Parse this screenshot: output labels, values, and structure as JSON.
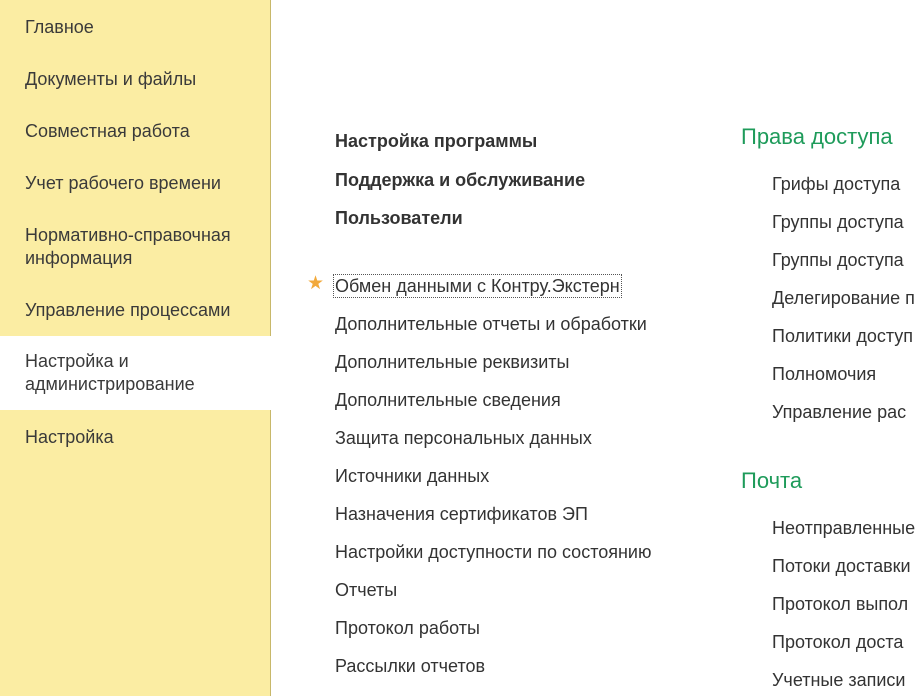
{
  "sidebar": {
    "items": [
      {
        "label": "Главное"
      },
      {
        "label": "Документы и файлы"
      },
      {
        "label": "Совместная работа"
      },
      {
        "label": "Учет рабочего времени"
      },
      {
        "label": "Нормативно-справочная информация"
      },
      {
        "label": "Управление процессами"
      },
      {
        "label": "Настройка и администрирование"
      },
      {
        "label": "Настройка"
      }
    ],
    "active_index": 6
  },
  "main": {
    "top_links": [
      {
        "label": "Настройка программы"
      },
      {
        "label": "Поддержка и обслуживание"
      },
      {
        "label": "Пользователи"
      }
    ],
    "favorite_link": {
      "label": "Обмен данными с Контру.Экстерн"
    },
    "links": [
      {
        "label": "Дополнительные отчеты и обработки"
      },
      {
        "label": "Дополнительные реквизиты"
      },
      {
        "label": "Дополнительные сведения"
      },
      {
        "label": "Защита персональных данных"
      },
      {
        "label": "Источники данных"
      },
      {
        "label": "Назначения сертификатов ЭП"
      },
      {
        "label": "Настройки доступности по состоянию"
      },
      {
        "label": "Отчеты"
      },
      {
        "label": "Протокол работы"
      },
      {
        "label": "Рассылки отчетов"
      }
    ]
  },
  "right_column": {
    "access": {
      "title": "Права доступа",
      "items": [
        {
          "label": "Грифы доступа"
        },
        {
          "label": "Группы доступа"
        },
        {
          "label": "Группы доступа"
        },
        {
          "label": "Делегирование п"
        },
        {
          "label": "Политики доступ"
        },
        {
          "label": "Полномочия"
        },
        {
          "label": "Управление рас"
        }
      ]
    },
    "mail": {
      "title": "Почта",
      "items": [
        {
          "label": "Неотправленные"
        },
        {
          "label": "Потоки доставки"
        },
        {
          "label": "Протокол выпол"
        },
        {
          "label": "Протокол доста"
        },
        {
          "label": "Учетные записи"
        }
      ]
    }
  },
  "colors": {
    "sidebar_bg": "#fbeda3",
    "section_title": "#1e9b5a",
    "star": "#f2a93b"
  }
}
